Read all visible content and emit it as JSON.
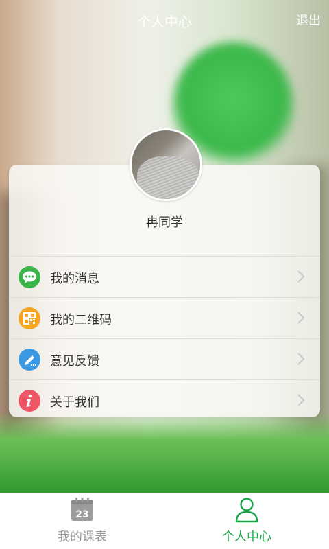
{
  "header": {
    "title": "个人中心",
    "logout_label": "退出"
  },
  "profile": {
    "name": "冉同学"
  },
  "menu": {
    "items": [
      {
        "label": "我的消息",
        "icon": "message-icon",
        "color": "#3ab54a"
      },
      {
        "label": "我的二维码",
        "icon": "qr-code-icon",
        "color": "#f5a623"
      },
      {
        "label": "意见反馈",
        "icon": "feedback-pencil-icon",
        "color": "#3a99e2"
      },
      {
        "label": "关于我们",
        "icon": "info-icon",
        "color": "#f05565"
      }
    ]
  },
  "tabbar": {
    "tabs": [
      {
        "label": "我的课表",
        "icon": "calendar-icon",
        "icon_text": "23",
        "active": false
      },
      {
        "label": "个人中心",
        "icon": "person-icon",
        "active": true
      }
    ]
  },
  "colors": {
    "active_tab": "#1aa34a",
    "inactive_tab": "#999999",
    "chevron": "#c8c8c8"
  }
}
